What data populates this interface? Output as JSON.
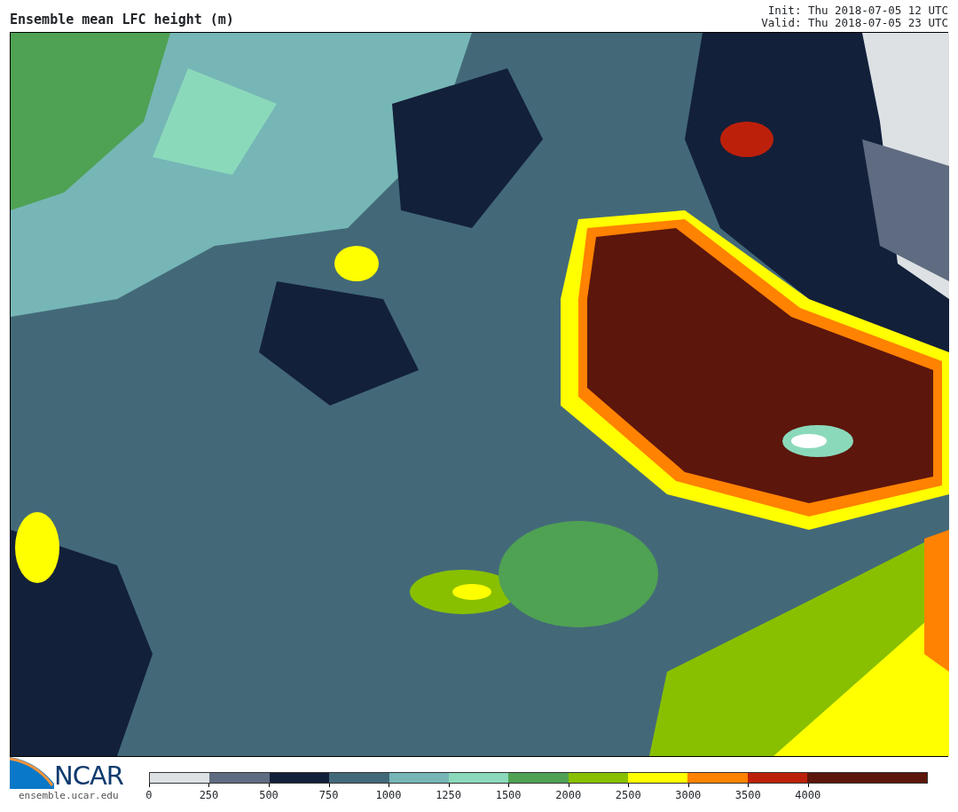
{
  "title": "Ensemble mean LFC height (m)",
  "init": "Init: Thu 2018-07-05 12 UTC",
  "valid": "Valid: Thu 2018-07-05 23 UTC",
  "logo": {
    "name": "NCAR",
    "url": "ensemble.ucar.edu"
  },
  "colorbar": [
    {
      "tick": "0",
      "color": "#dde1e4"
    },
    {
      "tick": "250",
      "color": "#5f6b80"
    },
    {
      "tick": "500",
      "color": "#13203a"
    },
    {
      "tick": "750",
      "color": "#436979"
    },
    {
      "tick": "1000",
      "color": "#76b6b6"
    },
    {
      "tick": "1250",
      "color": "#8bd9bb"
    },
    {
      "tick": "1500",
      "color": "#4fa153"
    },
    {
      "tick": "2000",
      "color": "#88c000"
    },
    {
      "tick": "2500",
      "color": "#ffff00"
    },
    {
      "tick": "3000",
      "color": "#ff8200"
    },
    {
      "tick": "3500",
      "color": "#bd200a"
    },
    {
      "tick": "4000",
      "color": "#5c160c"
    },
    {
      "color": "#5c160c"
    }
  ]
}
